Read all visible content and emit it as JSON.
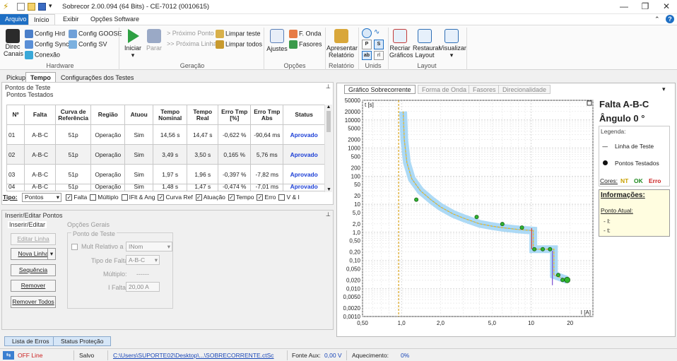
{
  "window": {
    "title": "Sobrecor 2.00.094 (64 Bits) - CE-7012 (0010615)"
  },
  "menu": {
    "tabs": [
      "Arquivo",
      "Início",
      "Exibir",
      "Opções Software"
    ],
    "active": "Início"
  },
  "ribbon": {
    "hardware": {
      "direc_line1": "Direc",
      "direc_line2": "Canais",
      "config_hrd": "Config Hrd",
      "config_sync": "Config Sync",
      "conexao": "Conexão",
      "config_goose": "Config GOOSE",
      "config_sv": "Config SV",
      "label": "Hardware"
    },
    "geracao": {
      "iniciar": "Iniciar",
      "parar": "Parar",
      "proximo_ponto": "Próximo Ponto",
      "proxima_linha": "Próxima Linha",
      "limpar_teste": "Limpar teste",
      "limpar_todos": "Limpar todos",
      "label": "Geração"
    },
    "opcoes": {
      "ajustes": "Ajustes",
      "f_onda": "F. Onda",
      "fasores": "Fasores",
      "label": "Opções"
    },
    "relatorio": {
      "line1": "Apresentar",
      "line2": "Relatório",
      "label": "Relatório"
    },
    "unids": {
      "label": "Unids"
    },
    "layout": {
      "recriar_l1": "Recriar",
      "recriar_l2": "Gráficos",
      "restaurar_l1": "Restaurar",
      "restaurar_l2": "Layout",
      "visualizar": "Visualizar",
      "label": "Layout"
    }
  },
  "subtabs": [
    "Pickup",
    "Tempo",
    "Configurações dos Testes"
  ],
  "points_panel": {
    "title": "Pontos de Teste",
    "subtitle": "Pontos Testados",
    "columns": [
      "Nº",
      "Falta",
      "Curva de Referência",
      "Região",
      "Atuou",
      "Tempo Nominal",
      "Tempo Real",
      "Erro Tmp [%]",
      "Erro Tmp Abs",
      "Status"
    ],
    "rows": [
      [
        "01",
        "A-B-C",
        "51p",
        "Operação",
        "Sim",
        "14,56 s",
        "14,47 s",
        "-0,622 %",
        "-90,64 ms",
        "Aprovado"
      ],
      [
        "02",
        "A-B-C",
        "51p",
        "Operação",
        "Sim",
        "3,49 s",
        "3,50 s",
        "0,165 %",
        "5,76 ms",
        "Aprovado"
      ],
      [
        "03",
        "A-B-C",
        "51p",
        "Operação",
        "Sim",
        "1,97 s",
        "1,96 s",
        "-0,397 %",
        "-7,82 ms",
        "Aprovado"
      ],
      [
        "04",
        "A-B-C",
        "51p",
        "Operação",
        "Sim",
        "1,48 s",
        "1,47 s",
        "-0,474 %",
        "-7,01 ms",
        "Aprovado"
      ]
    ]
  },
  "tipo_bar": {
    "label": "Tipo:",
    "value": "Pontos",
    "checks": [
      {
        "label": "Falta",
        "checked": true
      },
      {
        "label": "Múltiplo",
        "checked": false
      },
      {
        "label": "IFlt & Ang",
        "checked": false
      },
      {
        "label": "Curva Ref",
        "checked": true
      },
      {
        "label": "Atuação",
        "checked": true
      },
      {
        "label": "Tempo",
        "checked": true
      },
      {
        "label": "Erro",
        "checked": true
      },
      {
        "label": "V & I",
        "checked": false
      }
    ]
  },
  "insert_panel": {
    "title": "Inserir/Editar Pontos",
    "tab": "Inserir/Editar",
    "editar_linha": "Editar Linha",
    "nova_linha": "Nova Linha",
    "sequencia": "Sequência",
    "remover": "Remover",
    "remover_todos": "Remover Todos",
    "opcoes_gerais": "Opções Gerais",
    "ponto_teste": "Ponto de Teste",
    "mult_relativo": "Mult Relativo a ...",
    "mult_value": "INom",
    "tipo_falta_label": "Tipo de Falta:",
    "tipo_falta_value": "A-B-C",
    "multiplo_label": "Múltiplo:",
    "multiplo_value": "------",
    "ifalta_label": "I Falta:",
    "ifalta_value": "20,00 A"
  },
  "bottom_tabs": [
    "Lista de Erros",
    "Status Proteção"
  ],
  "status": {
    "state": "OFF Line",
    "saved": "Salvo",
    "path": "C:\\Users\\SUPORTE02\\Desktop\\...\\SOBRECORRENTE.ctSc",
    "fonte_label": "Fonte Aux:",
    "fonte_value": "0,00 V",
    "aquec_label": "Aquecimento:",
    "aquec_value": "0%"
  },
  "right_tabs": [
    "Gráfico Sobrecorrente",
    "Forma de Onda",
    "Fasores",
    "Direcionalidade"
  ],
  "info": {
    "falta": "Falta A-B-C",
    "angulo": "Ângulo 0 °",
    "legenda": "Legenda:",
    "linha_teste": "Linha de Teste",
    "pontos_testados": "Pontos Testados",
    "cores": "Cores:",
    "nt": "NT",
    "ok": "OK",
    "erro": "Erro",
    "informacoes": "Informações:",
    "ponto_atual": "Ponto Atual:",
    "i_label": "- I:",
    "t_label": "- t:"
  },
  "chart_data": {
    "type": "scatter",
    "xlabel": "I [A]",
    "ylabel": "t [s]",
    "xscale": "log",
    "yscale": "log",
    "xlim": [
      0.5,
      30
    ],
    "ylim": [
      0.001,
      50000
    ],
    "xticks": [
      0.5,
      1.0,
      2.0,
      5.0,
      10,
      20
    ],
    "xtick_labels": [
      "0,50",
      "1,0",
      "2,0",
      "5,0",
      "10",
      "20"
    ],
    "yticks": [
      0.001,
      0.002,
      0.005,
      0.01,
      0.02,
      0.05,
      0.1,
      0.2,
      0.5,
      1,
      2,
      5,
      10,
      20,
      50,
      100,
      200,
      500,
      1000,
      2000,
      5000,
      10000,
      20000,
      50000
    ],
    "ytick_labels": [
      "0,0010",
      "0,0020",
      "0,0050",
      "0,010",
      "0,020",
      "0,050",
      "0,10",
      "0,20",
      "0,50",
      "1,0",
      "2,0",
      "5,0",
      "10",
      "20",
      "50",
      "100",
      "200",
      "500",
      "1000",
      "2000",
      "5000",
      "10000",
      "20000",
      "50000"
    ],
    "grid": true,
    "test_line_x": 0.95,
    "curve": {
      "x": [
        1.03,
        1.05,
        1.1,
        1.2,
        1.4,
        1.7,
        2.0,
        2.5,
        3.0,
        4.0,
        5.0,
        6.0,
        8.0,
        10.4,
        10.4,
        15.0,
        15.0,
        19.0
      ],
      "y": [
        20000,
        2000,
        300,
        80,
        30,
        14,
        8,
        4.5,
        3.2,
        2.0,
        1.65,
        1.45,
        1.25,
        1.15,
        0.25,
        0.25,
        0.03,
        0.02
      ]
    },
    "points": {
      "x": [
        1.3,
        3.8,
        6.0,
        8.5,
        10.6,
        12.3,
        14.0,
        16.2,
        17.5,
        19.0
      ],
      "y": [
        14.5,
        3.5,
        1.96,
        1.47,
        0.25,
        0.25,
        0.25,
        0.03,
        0.02,
        0.02
      ]
    }
  },
  "colors": {
    "accent": "#1e6fc4",
    "approved": "#1c3fd6",
    "curve_band": "#9fd4f4",
    "curve_line": "#e8b82b",
    "test_line": "#d8a21a",
    "point": "#2fb52f",
    "offline": "#cc2222"
  }
}
